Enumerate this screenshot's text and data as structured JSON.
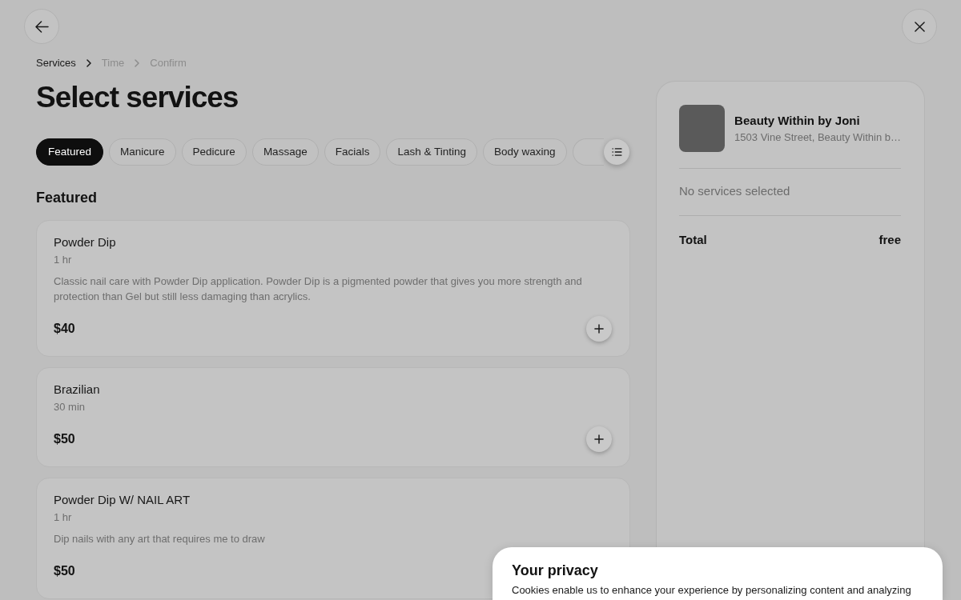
{
  "breadcrumb": [
    {
      "label": "Services",
      "selected": true
    },
    {
      "label": "Time",
      "selected": false
    },
    {
      "label": "Confirm",
      "selected": false
    }
  ],
  "title": "Select services",
  "categories": [
    {
      "label": "Featured",
      "selected": true
    },
    {
      "label": "Manicure",
      "selected": false
    },
    {
      "label": "Pedicure",
      "selected": false
    },
    {
      "label": "Massage",
      "selected": false
    },
    {
      "label": "Facials",
      "selected": false
    },
    {
      "label": "Lash & Tinting",
      "selected": false
    },
    {
      "label": "Body waxing",
      "selected": false
    }
  ],
  "section_title": "Featured",
  "services": [
    {
      "name": "Powder Dip",
      "duration": "1 hr",
      "description": "Classic nail care with Powder Dip application. Powder Dip is a pigmented powder that gives you more strength and protection than Gel but still less damaging than acrylics.",
      "price": "$40",
      "show_add": true
    },
    {
      "name": "Brazilian",
      "duration": "30 min",
      "price": "$50",
      "show_add": true
    },
    {
      "name": "Powder Dip W/ NAIL ART",
      "duration": "1 hr",
      "description": "Dip nails with any art that requires me to draw",
      "price": "$50"
    }
  ],
  "summary": {
    "business_name": "Beauty Within by Joni",
    "address": "1503 Vine Street, Beauty Within b…",
    "empty_message": "No services selected",
    "total_label": "Total",
    "total_value": "free"
  },
  "cookie_banner": {
    "title": "Your privacy",
    "text": "Cookies enable us to enhance your experience by personalizing content and analyzing"
  }
}
